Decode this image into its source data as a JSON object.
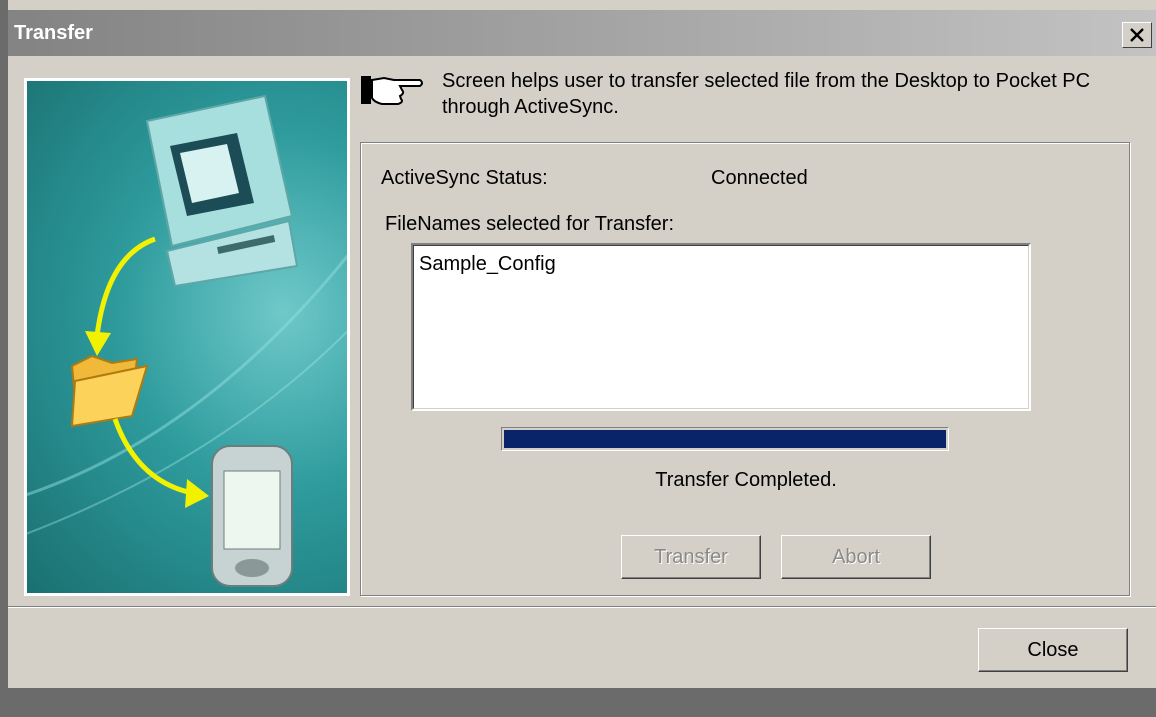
{
  "window": {
    "title": "Transfer",
    "close_icon": "close-x-icon"
  },
  "hint": {
    "icon": "pointing-hand-icon",
    "text": "Screen helps user to transfer selected file from the Desktop to Pocket PC through ActiveSync."
  },
  "status": {
    "label": "ActiveSync Status:",
    "value": "Connected"
  },
  "files": {
    "label": "FileNames selected for Transfer:",
    "items": [
      "Sample_Config"
    ]
  },
  "progress": {
    "percent": 100,
    "fill_color": "#0a246a",
    "message": "Transfer Completed."
  },
  "buttons": {
    "transfer": "Transfer",
    "abort": "Abort",
    "close": "Close"
  },
  "illustration": {
    "icons": [
      "desktop-computer-icon",
      "folder-icon",
      "pocket-pc-icon"
    ],
    "arrow_color": "#f2f200"
  }
}
